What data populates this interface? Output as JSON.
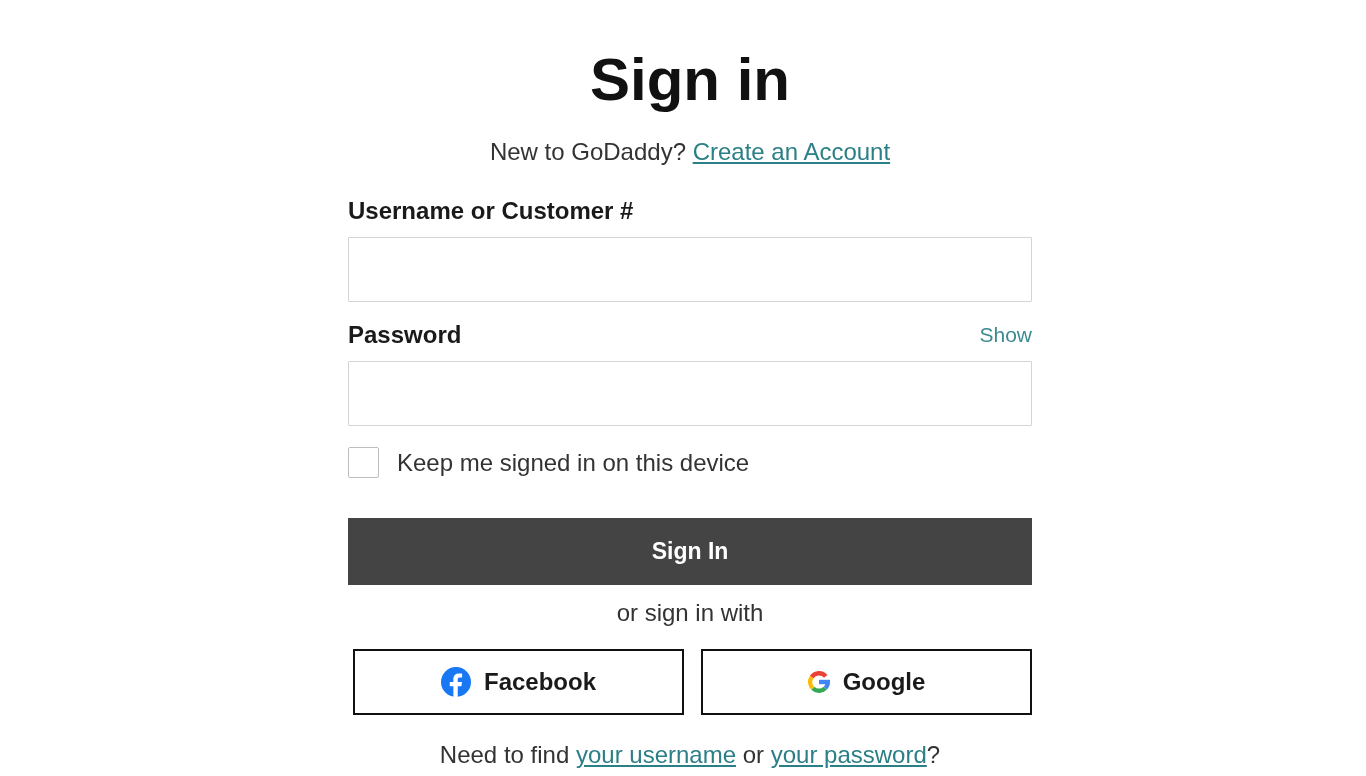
{
  "title": "Sign in",
  "signup_prompt": {
    "text": "New to GoDaddy?",
    "link": "Create an Account"
  },
  "username": {
    "label": "Username or Customer #"
  },
  "password": {
    "label": "Password",
    "toggle": "Show"
  },
  "remember_me": {
    "label": "Keep me signed in on this device",
    "checked": false
  },
  "sign_in_button": "Sign In",
  "divider_text": "or sign in with",
  "social_buttons": [
    {
      "kind": "facebook",
      "label": "Facebook"
    },
    {
      "kind": "google",
      "label": "Google"
    }
  ],
  "help": [
    {
      "kind": "text",
      "text": "Need to find "
    },
    {
      "kind": "link",
      "text": "your username"
    },
    {
      "kind": "text",
      "text": " or "
    },
    {
      "kind": "link",
      "text": "your password"
    },
    {
      "kind": "text",
      "text": "?"
    }
  ]
}
